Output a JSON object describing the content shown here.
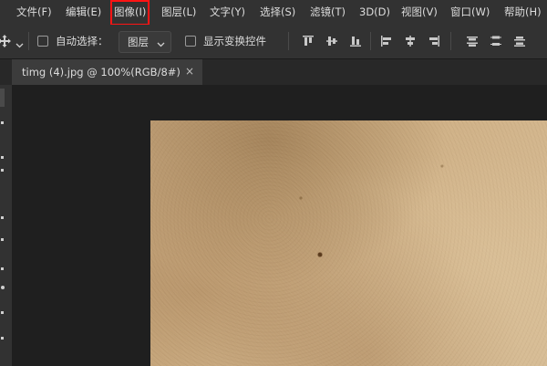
{
  "menubar": {
    "items": [
      {
        "label": "文件(F)"
      },
      {
        "label": "编辑(E)"
      },
      {
        "label": "图像(I)"
      },
      {
        "label": "图层(L)"
      },
      {
        "label": "文字(Y)"
      },
      {
        "label": "选择(S)"
      },
      {
        "label": "滤镜(T)"
      },
      {
        "label": "3D(D)"
      },
      {
        "label": "视图(V)"
      },
      {
        "label": "窗口(W)"
      },
      {
        "label": "帮助(H)"
      }
    ],
    "highlight_color": "#ff1414"
  },
  "options_bar": {
    "tool_icon": "move-tool-icon",
    "auto_select_label": "自动选择：",
    "auto_select_checked": false,
    "auto_select_target": "图层",
    "show_transform_label": "显示变换控件",
    "show_transform_checked": false,
    "align_icons": [
      "align-top-icon",
      "align-vertical-center-icon",
      "align-bottom-icon",
      "align-left-icon",
      "align-horizontal-center-icon",
      "align-right-icon",
      "distribute-top-icon",
      "distribute-vertical-center-icon",
      "distribute-bottom-icon"
    ]
  },
  "document_tab": {
    "title": "timg (4).jpg @ 100%(RGB/8#)",
    "close_label": "×"
  },
  "colors": {
    "ui_background": "#323232",
    "workspace": "#1f1f1f",
    "paper": "#cdae83"
  }
}
